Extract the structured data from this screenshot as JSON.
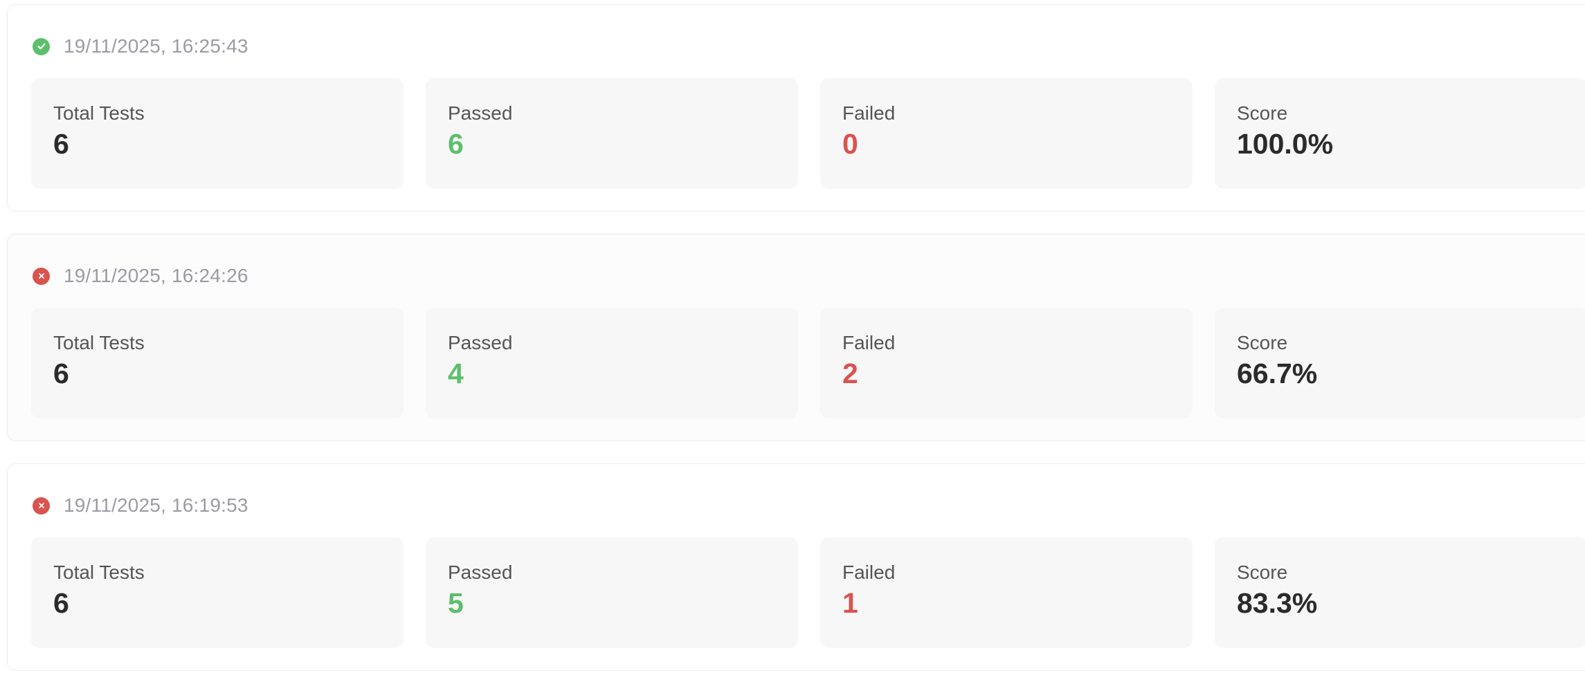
{
  "colors": {
    "pass": "#5cbf6b",
    "fail": "#d9534f",
    "timestamp": "#9b9ba3",
    "value": "#2b2b2b"
  },
  "runs": [
    {
      "status": "passed",
      "status_icon": "check-circle-icon",
      "timestamp": "19/11/2025, 16:25:43",
      "total_label": "Total Tests",
      "total": "6",
      "passed_label": "Passed",
      "passed": "6",
      "failed_label": "Failed",
      "failed": "0",
      "score_label": "Score",
      "score": "100.0%"
    },
    {
      "status": "failed",
      "status_icon": "x-circle-icon",
      "timestamp": "19/11/2025, 16:24:26",
      "total_label": "Total Tests",
      "total": "6",
      "passed_label": "Passed",
      "passed": "4",
      "failed_label": "Failed",
      "failed": "2",
      "score_label": "Score",
      "score": "66.7%"
    },
    {
      "status": "failed",
      "status_icon": "x-circle-icon",
      "timestamp": "19/11/2025, 16:19:53",
      "total_label": "Total Tests",
      "total": "6",
      "passed_label": "Passed",
      "passed": "5",
      "failed_label": "Failed",
      "failed": "1",
      "score_label": "Score",
      "score": "83.3%"
    }
  ]
}
